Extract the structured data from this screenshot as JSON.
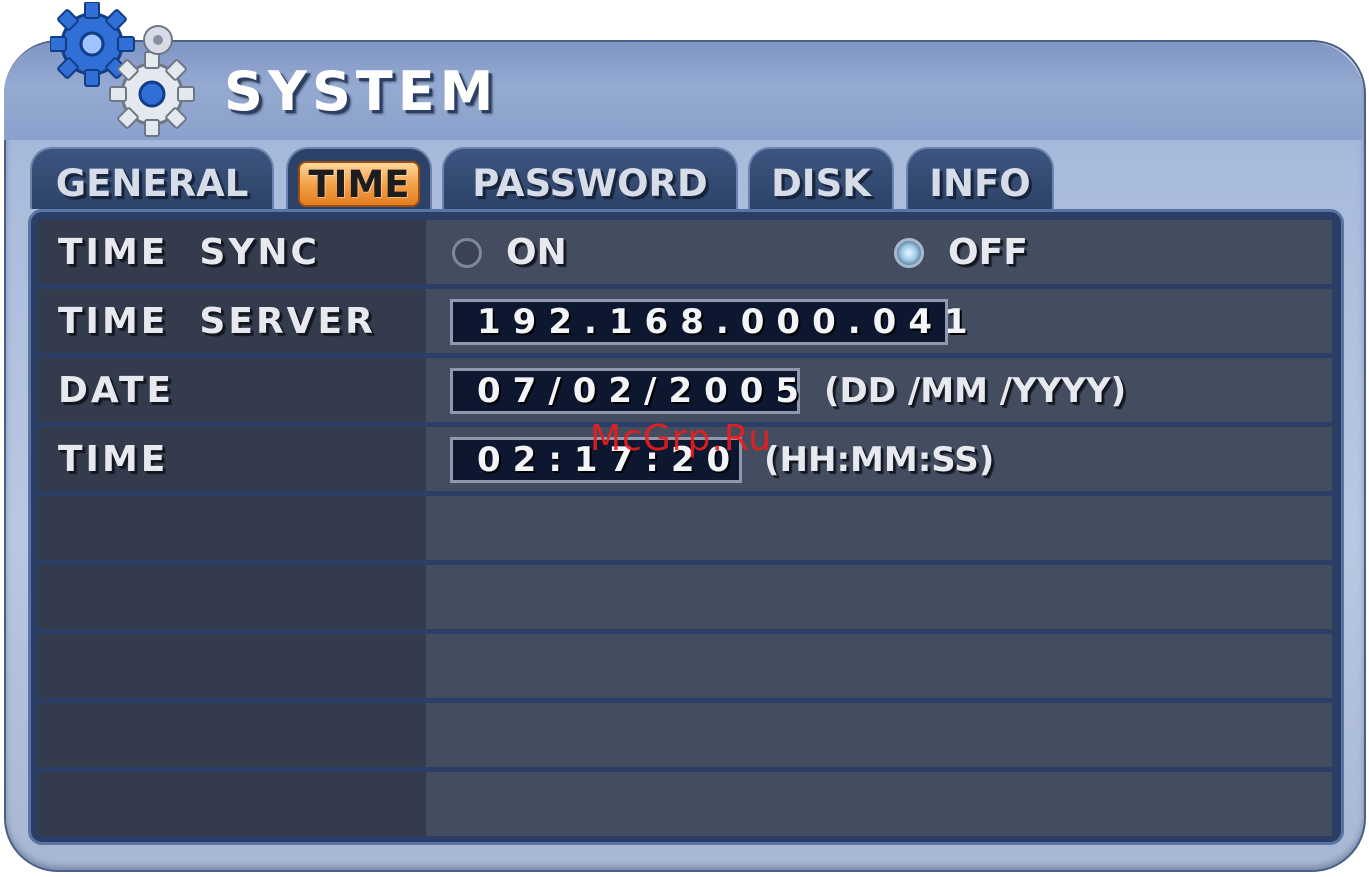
{
  "window": {
    "title": "SYSTEM"
  },
  "tabs": [
    {
      "label": "GENERAL",
      "active": false
    },
    {
      "label": "TIME",
      "active": true
    },
    {
      "label": "PASSWORD",
      "active": false
    },
    {
      "label": "DISK",
      "active": false
    },
    {
      "label": "INFO",
      "active": false
    }
  ],
  "settings": {
    "time_sync": {
      "label": "TIME  SYNC",
      "options": [
        "ON",
        "OFF"
      ],
      "selected": "OFF"
    },
    "time_server": {
      "label": "TIME  SERVER",
      "value": "192.168.000.041"
    },
    "date": {
      "label": "DATE",
      "value": "07/02/2005",
      "format": "(DD /MM /YYYY)"
    },
    "time": {
      "label": "TIME",
      "value": "02:17:20",
      "format": "(HH:MM:SS)"
    }
  },
  "watermark": "McGrp.Ru",
  "colors": {
    "active_tab": "#f4a24b",
    "panel": "#2b3f66",
    "field_bg": "#0d1830",
    "watermark": "#eb1e1e"
  },
  "icons": [
    "gears-icon"
  ]
}
